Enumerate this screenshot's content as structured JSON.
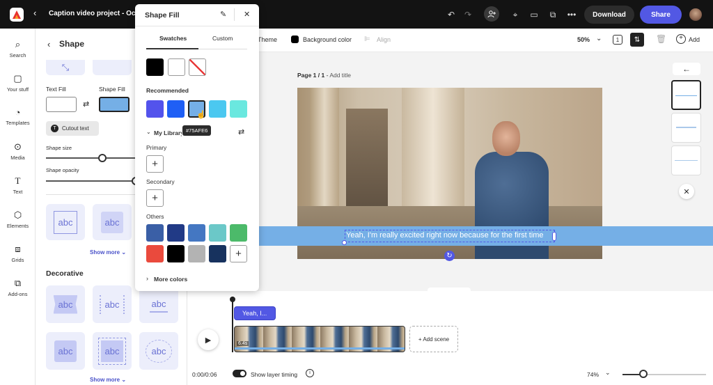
{
  "topbar": {
    "project_title": "Caption video project - Octobe",
    "download": "Download",
    "share": "Share"
  },
  "rail": {
    "items": [
      {
        "label": "Search"
      },
      {
        "label": "Your stuff"
      },
      {
        "label": "Templates"
      },
      {
        "label": "Media"
      },
      {
        "label": "Text"
      },
      {
        "label": "Elements"
      },
      {
        "label": "Grids"
      },
      {
        "label": "Add-ons"
      }
    ]
  },
  "shape_panel": {
    "title": "Shape",
    "text_fill_label": "Text Fill",
    "shape_fill_label": "Shape Fill",
    "cutout_text": "Cutout text",
    "shape_size_label": "Shape size",
    "shape_opacity_label": "Shape opacity",
    "show_more_1": "Show more",
    "decorative_heading": "Decorative",
    "show_more_2": "Show more",
    "tile_text": "abc"
  },
  "popup": {
    "title": "Shape Fill",
    "tab_swatches": "Swatches",
    "tab_custom": "Custom",
    "recommended": "Recommended",
    "tooltip": "#75AFE6",
    "my_library": "My Library",
    "primary": "Primary",
    "secondary": "Secondary",
    "others": "Others",
    "more_colors": "More colors",
    "swatch_colors": [
      "#000000",
      "#ffffff"
    ],
    "recommended_colors": [
      "#5353ec",
      "#1f5ff5",
      "#75afe6",
      "#4bc8f0",
      "#6ae8df"
    ],
    "others_colors": [
      "#3a5fa6",
      "#213a86",
      "#4477c2",
      "#6bc8c8",
      "#4cba6a",
      "#ea4a3d",
      "#000000",
      "#b3b3b3",
      "#17325e"
    ]
  },
  "toolbar": {
    "theme": "Theme",
    "background_color": "Background color",
    "align": "Align",
    "zoom": "50%",
    "add": "Add"
  },
  "canvas": {
    "page_label": "Page 1 / 1",
    "add_title": "Add title",
    "caption": "Yeah, I'm really excited right now because for the first time"
  },
  "timeline": {
    "clip_label": "Yeah, I...",
    "duration": "6.4s",
    "add_scene": "+ Add scene",
    "time": "0:00/0:06",
    "show_layer_timing": "Show layer timing",
    "zoom": "74%"
  }
}
